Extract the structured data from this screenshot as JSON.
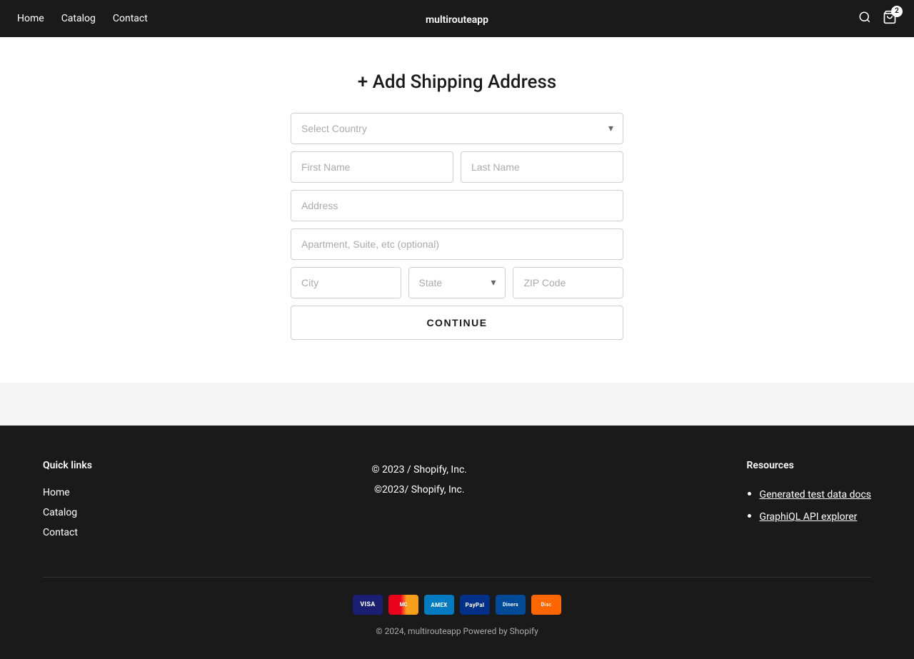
{
  "nav": {
    "links": [
      "Home",
      "Catalog",
      "Contact"
    ],
    "brand": "multirouteapp",
    "cart_count": "2"
  },
  "main": {
    "title": "+ Add Shipping Address",
    "form": {
      "country_placeholder": "Select Country",
      "first_name_placeholder": "First Name",
      "last_name_placeholder": "Last Name",
      "address_placeholder": "Address",
      "apt_placeholder": "Apartment, Suite, etc (optional)",
      "city_placeholder": "City",
      "state_placeholder": "State",
      "zip_placeholder": "ZIP Code",
      "continue_label": "CONTINUE"
    }
  },
  "footer": {
    "quick_links_heading": "Quick links",
    "quick_links": [
      "Home",
      "Catalog",
      "Contact"
    ],
    "copyright_center": "© 2023 / Shopify, Inc.",
    "copyright_center2": "©2023/ Shopify, Inc.",
    "resources_heading": "Resources",
    "resources_links": [
      "Generated test data docs",
      "GraphiQL API explorer"
    ],
    "bottom_copy": "© 2024, multirouteapp Powered by Shopify"
  },
  "payment_methods": [
    {
      "name": "Visa",
      "class": "pi-visa",
      "label": "VISA"
    },
    {
      "name": "Mastercard",
      "class": "pi-mc",
      "label": "MC"
    },
    {
      "name": "American Express",
      "class": "pi-amex",
      "label": "AMEX"
    },
    {
      "name": "PayPal",
      "class": "pi-pp",
      "label": "PayPal"
    },
    {
      "name": "Diners Club",
      "class": "pi-diners",
      "label": "Diners"
    },
    {
      "name": "Discover",
      "class": "pi-discover",
      "label": "Disc"
    }
  ]
}
